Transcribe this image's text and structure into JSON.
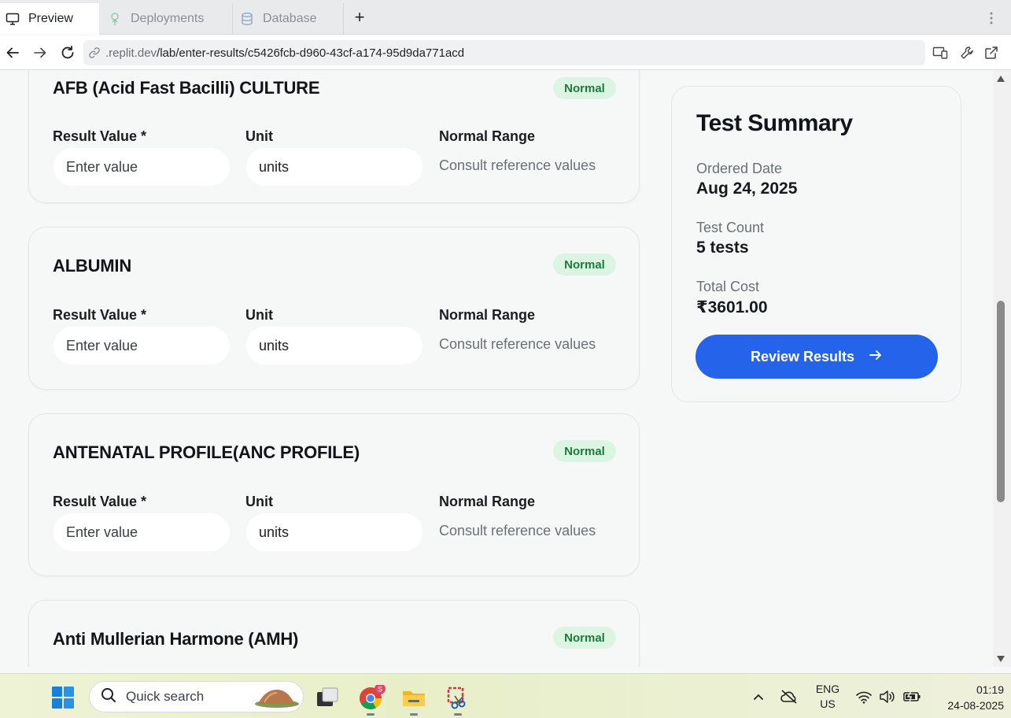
{
  "browser": {
    "tabs": [
      {
        "label": "Preview",
        "icon": "monitor-icon",
        "active": true
      },
      {
        "label": "Deployments",
        "icon": "deployments-icon",
        "active": false
      },
      {
        "label": "Database",
        "icon": "database-icon",
        "active": false
      }
    ],
    "url_host": ".replit.dev",
    "url_path": "/lab/enter-results/c5426fcb-d960-43cf-a174-95d9da771acd"
  },
  "tests": [
    {
      "name": "AFB (Acid Fast Bacilli) CULTURE",
      "status": "Normal",
      "result_label": "Result Value *",
      "result_placeholder": "Enter value",
      "unit_label": "Unit",
      "unit_value": "units",
      "range_label": "Normal Range",
      "range_value": "Consult reference values"
    },
    {
      "name": "ALBUMIN",
      "status": "Normal",
      "result_label": "Result Value *",
      "result_placeholder": "Enter value",
      "unit_label": "Unit",
      "unit_value": "units",
      "range_label": "Normal Range",
      "range_value": "Consult reference values"
    },
    {
      "name": "ANTENATAL PROFILE(ANC PROFILE)",
      "status": "Normal",
      "result_label": "Result Value *",
      "result_placeholder": "Enter value",
      "unit_label": "Unit",
      "unit_value": "units",
      "range_label": "Normal Range",
      "range_value": "Consult reference values"
    },
    {
      "name": "Anti Mullerian Harmone (AMH)",
      "status": "Normal"
    }
  ],
  "summary": {
    "title": "Test Summary",
    "ordered_date_label": "Ordered Date",
    "ordered_date": "Aug 24, 2025",
    "test_count_label": "Test Count",
    "test_count": "5 tests",
    "total_cost_label": "Total Cost",
    "total_cost": "₹3601.00",
    "review_button": "Review Results"
  },
  "taskbar": {
    "search_placeholder": "Quick search",
    "chrome_badge": "S",
    "language": "ENG",
    "region": "US",
    "time": "01:19",
    "date": "24-08-2025"
  },
  "colors": {
    "accent": "#2563eb",
    "badge_bg": "#dcf5e3",
    "badge_text": "#1d7a3e"
  }
}
